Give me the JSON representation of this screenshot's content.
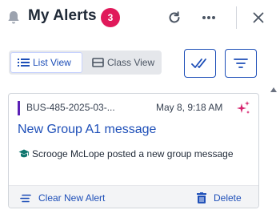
{
  "header": {
    "title": "My Alerts",
    "badge_count": "3",
    "icons": [
      "bell-icon",
      "refresh-icon",
      "more-horizontal-icon",
      "close-icon"
    ]
  },
  "toolbar": {
    "list_view_label": "List View",
    "class_view_label": "Class View",
    "selected_view": "List View",
    "icons": [
      "list-icon",
      "class-view-icon",
      "double-check-icon",
      "filter-icon"
    ]
  },
  "alert": {
    "reference": "BUS-485-2025-03-...",
    "timestamp": "May 8, 9:18 AM",
    "title": "New Group A1 message",
    "body": "Scrooge McLope posted a new group message",
    "clear_label": "Clear New Alert",
    "delete_label": "Delete",
    "accent_color": "#5b21b6",
    "icons": [
      "sparkle-icon",
      "graduation-cap-icon",
      "clear-lines-icon",
      "trash-icon"
    ]
  },
  "colors": {
    "brand_blue": "#1e4fb8",
    "badge_pink": "#e0195a"
  }
}
